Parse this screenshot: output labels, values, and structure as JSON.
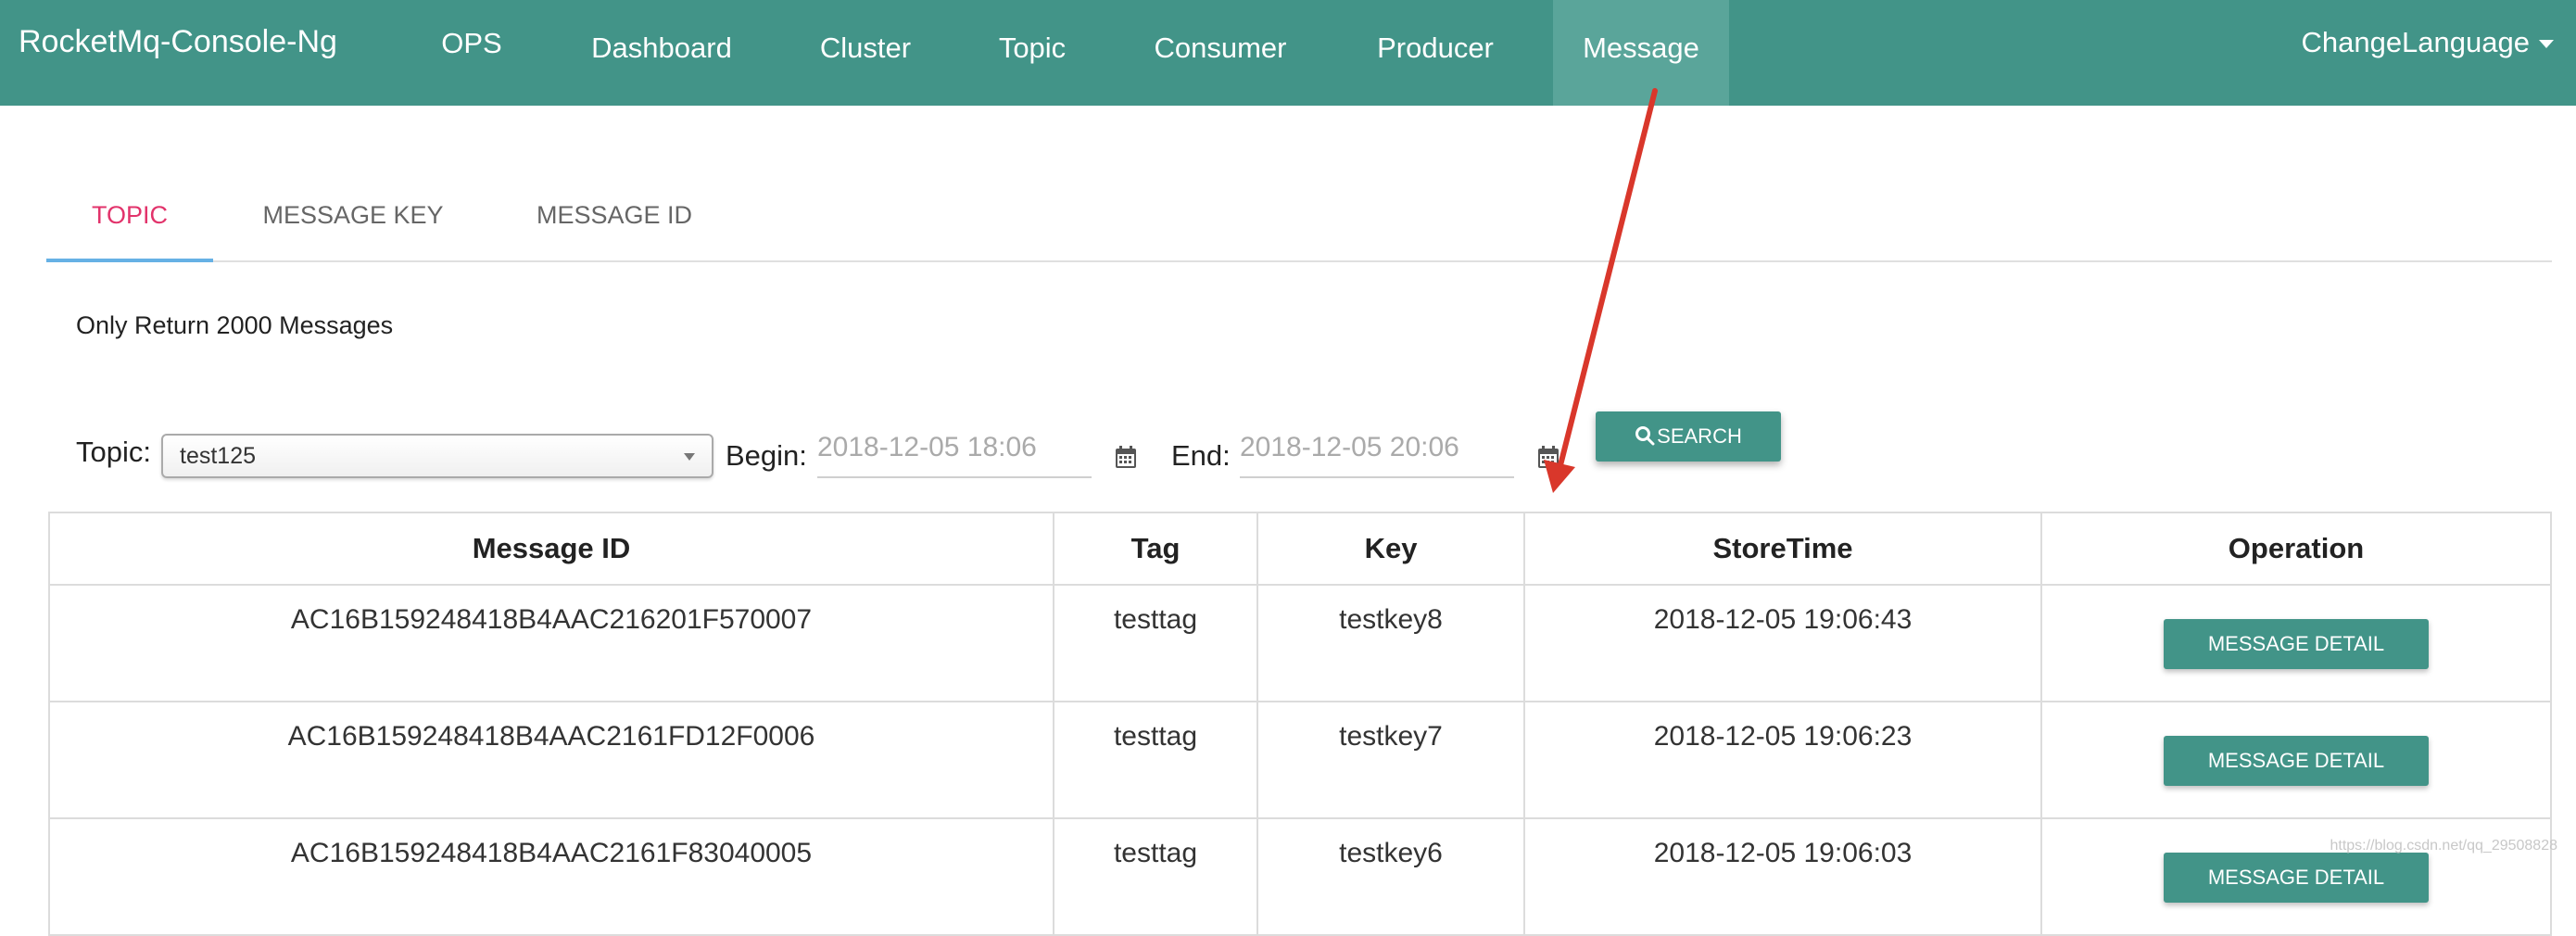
{
  "navbar": {
    "brand": "RocketMq-Console-Ng",
    "items": [
      {
        "label": "OPS"
      },
      {
        "label": "Dashboard"
      },
      {
        "label": "Cluster"
      },
      {
        "label": "Topic"
      },
      {
        "label": "Consumer"
      },
      {
        "label": "Producer"
      },
      {
        "label": "Message"
      }
    ],
    "active": "Message",
    "change_language": "ChangeLanguage"
  },
  "tabs": [
    {
      "label": "TOPIC",
      "active": true
    },
    {
      "label": "MESSAGE KEY",
      "active": false
    },
    {
      "label": "MESSAGE ID",
      "active": false
    }
  ],
  "notice": "Only Return 2000 Messages",
  "filters": {
    "topic_label": "Topic:",
    "topic_value": "test125",
    "begin_label": "Begin:",
    "begin_value": "2018-12-05 18:06",
    "end_label": "End:",
    "end_value": "2018-12-05 20:06",
    "search_label": "SEARCH"
  },
  "table": {
    "headers": [
      "Message ID",
      "Tag",
      "Key",
      "StoreTime",
      "Operation"
    ],
    "rows": [
      {
        "id": "AC16B159248418B4AAC216201F570007",
        "tag": "testtag",
        "key": "testkey8",
        "time": "2018-12-05 19:06:43",
        "action": "MESSAGE DETAIL"
      },
      {
        "id": "AC16B159248418B4AAC2161FD12F0006",
        "tag": "testtag",
        "key": "testkey7",
        "time": "2018-12-05 19:06:23",
        "action": "MESSAGE DETAIL"
      },
      {
        "id": "AC16B159248418B4AAC2161F83040005",
        "tag": "testtag",
        "key": "testkey6",
        "time": "2018-12-05 19:06:03",
        "action": "MESSAGE DETAIL"
      }
    ]
  },
  "colors": {
    "brand": "#429488",
    "nav_active": "#5aa59a",
    "tab_active_text": "#e2336b",
    "tab_indicator": "#66b1e5",
    "annotation_arrow": "#d9372b"
  },
  "icons": {
    "calendar": "calendar-icon",
    "search": "search-icon",
    "dropdown": "chevron-down-icon"
  },
  "watermark": "https://blog.csdn.net/qq_29508828"
}
